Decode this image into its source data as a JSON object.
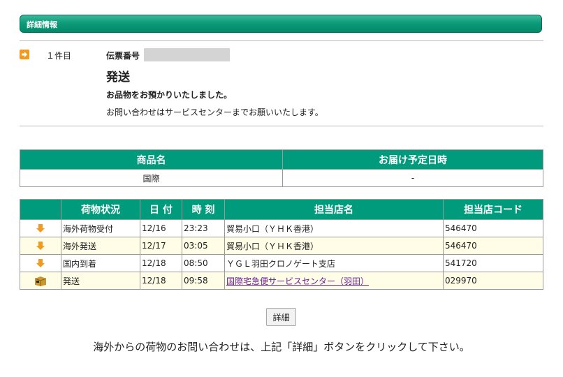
{
  "header": {
    "title": "詳細情報"
  },
  "item": {
    "count_label": "１件目",
    "slip_label": "伝票番号",
    "status_title": "発送",
    "status_message": "お品物をお預かりいたしました。",
    "inquiry_message": "お問い合わせはサービスセンターまでお願いいたします。"
  },
  "product_table": {
    "headers": [
      "商品名",
      "お届け予定日時"
    ],
    "row": [
      "国際",
      "-"
    ]
  },
  "tracking_table": {
    "headers": [
      "荷物状況",
      "日 付",
      "時 刻",
      "担当店名",
      "担当店コード"
    ],
    "rows": [
      {
        "icon": "down-arrow-icon",
        "status": "海外荷物受付",
        "date": "12/16",
        "time": "23:23",
        "shop": "貿易小口（ＹＨＫ香港）",
        "code": "546470"
      },
      {
        "icon": "down-arrow-icon",
        "status": "海外発送",
        "date": "12/17",
        "time": "03:05",
        "shop": "貿易小口（ＹＨＫ香港）",
        "code": "546470"
      },
      {
        "icon": "down-arrow-icon",
        "status": "国内到着",
        "date": "12/18",
        "time": "08:50",
        "shop": "ＹＧＬ羽田クロノゲート支店",
        "code": "541720"
      },
      {
        "icon": "package-icon",
        "status": "発送",
        "date": "12/18",
        "time": "09:58",
        "shop": "国際宅急便サービスセンター（羽田）",
        "code": "029970"
      }
    ]
  },
  "detail_button": {
    "label": "詳細"
  },
  "footer": {
    "note": "海外からの荷物のお問い合わせは、上記「詳細」ボタンをクリックして下さい。"
  },
  "colors": {
    "header_green": "#009a7c",
    "alt_row": "#fffde6",
    "arrow_orange": "#f39a1e",
    "link": "#6a1b9a"
  }
}
